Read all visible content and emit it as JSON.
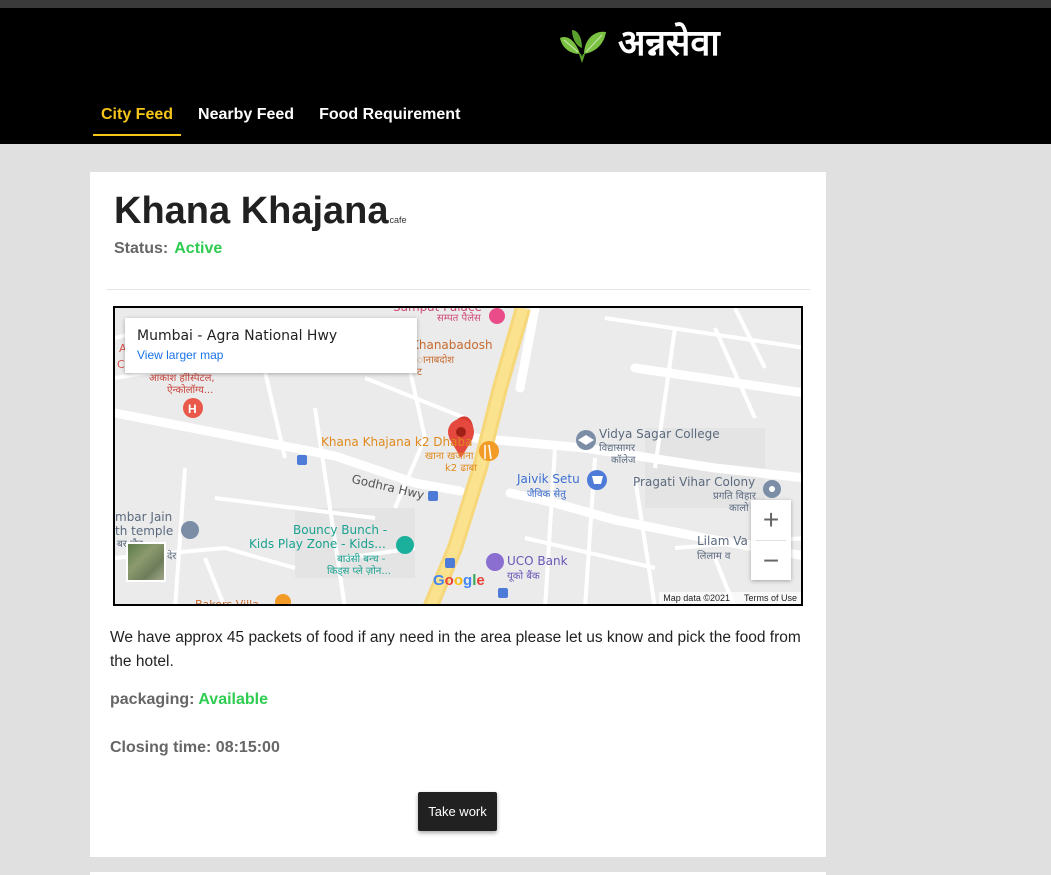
{
  "brand": {
    "name": "अन्नसेवा",
    "logo_icon": "leaves-icon",
    "logo_color": "#7cc242"
  },
  "nav": {
    "items": [
      {
        "label": "City Feed",
        "active": true
      },
      {
        "label": "Nearby Feed",
        "active": false
      },
      {
        "label": "Food Requirement",
        "active": false
      }
    ],
    "active_color": "#f5c518"
  },
  "post": {
    "title": "Khana Khajana",
    "type_tag": "cafe",
    "status_label": "Status:",
    "status_value": "Active",
    "status_color": "#2ecc50",
    "description": "We have approx 45 packets of food if any need in the area please let us know and pick the food from the hotel.",
    "packaging_label": "packaging:",
    "packaging_value": "Available",
    "closing_label": "Closing time:",
    "closing_value": "08:15:00",
    "action_label": "Take work"
  },
  "map": {
    "info_title": "Mumbai - Agra National Hwy",
    "info_link": "View larger map",
    "zoom_in": "+",
    "zoom_out": "−",
    "attribution": "Map data ©2021",
    "terms": "Terms of Use",
    "google": [
      "G",
      "o",
      "o",
      "g",
      "l",
      "e"
    ],
    "labels": {
      "sampat_hi": "सम्पत पैलेस",
      "sampat_en": "Sampat Palace",
      "khanabadosh": "Khanabadosh",
      "khanabadosh_hi": "ानाबदोश",
      "khanabadosh_hi2": "ट",
      "akash_hi1": "आकाश हॉस्पिटल,",
      "akash_hi2": "ऐन्कोलॉग्य...",
      "khana_en": "Khana Khajana k2 Dhaba",
      "khana_hi1": "खाना खजाना",
      "khana_hi2": "k2 ढाबा",
      "vidya_en": "Vidya Sagar College",
      "vidya_hi1": "विद्यासागर",
      "vidya_hi2": "कॉलेज",
      "jaivik_en": "Jaivik Setu",
      "jaivik_hi": "जैविक सेतु",
      "pragati_en": "Pragati Vihar Colony",
      "pragati_hi1": "प्रगति विहार",
      "pragati_hi2": "कालो",
      "godhra": "Godhra Hwy",
      "jain1": "mbar Jain",
      "jain2": "th temple",
      "jain3": "बर जैन",
      "jain4": "देर",
      "bouncy1": "Bouncy Bunch -",
      "bouncy2": "Kids Play Zone -  Kids...",
      "bouncy3": "बाउंसी बन्च -",
      "bouncy4": "किड्स प्ले ज़ोन...",
      "uco_en": "UCO Bank",
      "uco_hi": "यूको बैंक",
      "lilam_en": "Lilam Va",
      "lilam_hi": "लिलाम व",
      "bakers": "Bakers Villa",
      "edge_a": "A",
      "edge_c": "C"
    }
  }
}
